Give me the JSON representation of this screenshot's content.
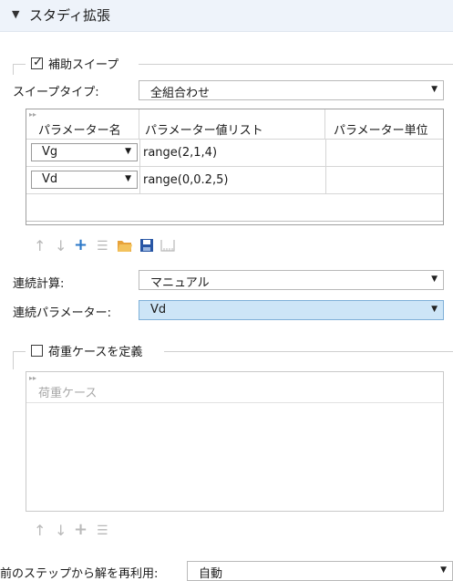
{
  "section": {
    "title": "スタディ拡張",
    "expand_glyph": "▼"
  },
  "aux_sweep": {
    "checkbox_label": "補助スイープ",
    "checked": true,
    "sweep_type_label": "スイープタイプ:",
    "sweep_type_value": "全組合わせ",
    "table": {
      "columns": [
        "パラメーター名",
        "パラメーター値リスト",
        "パラメーター単位"
      ],
      "rows": [
        {
          "name": "Vg",
          "values": "range(2,1,4)",
          "unit": ""
        },
        {
          "name": "Vd",
          "values": "range(0,0.2,5)",
          "unit": ""
        }
      ]
    },
    "toolbar_icons": [
      "move-up-icon",
      "move-down-icon",
      "add-icon",
      "delete-icon",
      "load-from-file-icon",
      "save-icon",
      "range-icon"
    ],
    "continuation_label": "連続計算:",
    "continuation_value": "マニュアル",
    "continuation_param_label": "連続パラメーター:",
    "continuation_param_value": "Vd"
  },
  "load_cases": {
    "checkbox_label": "荷重ケースを定義",
    "checked": false,
    "table_header": "荷重ケース",
    "toolbar_icons": [
      "move-up-icon",
      "move-down-icon",
      "add-icon",
      "delete-icon"
    ]
  },
  "reuse": {
    "label": "前のステップから解を再利用:",
    "value": "自動"
  },
  "glyphs": {
    "chevron": "▼",
    "check": "✓",
    "up": "↑",
    "down": "↓",
    "plus": "+",
    "list_delete": "☰",
    "folder": "📂",
    "save": "💾",
    "range": "⎍",
    "header_expand": "▸▸"
  }
}
